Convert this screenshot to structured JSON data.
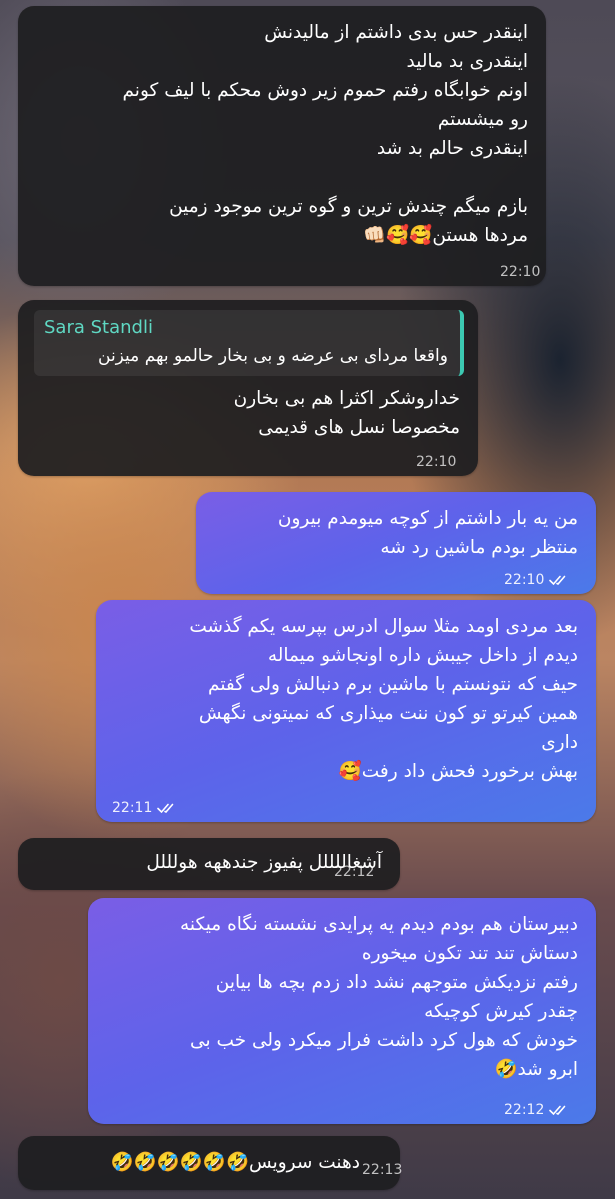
{
  "messages": [
    {
      "id": "m1",
      "side": "incoming",
      "lines": [
        "اینقدر حس بدی داشتم از مالیدنش",
        "اینقدری بد مالید",
        "اونم خوابگاه رفتم حموم زیر دوش محکم با لیف کونم",
        "رو میشستم",
        "اینقدری حالم بد شد",
        "",
        "بازم میگم چندش ترین و گوه ترین موجود زمین",
        "مردها هستن🥰🥰👊🏻"
      ],
      "time": "22:10"
    },
    {
      "id": "m2",
      "side": "incoming",
      "reply": {
        "sender": "Sara Standli",
        "text": "واقعا مردای بی عرضه و بی بخار حالمو بهم میزنن"
      },
      "lines": [
        "خداروشکر اکثرا هم بی بخارن",
        "مخصوصا نسل های قدیمی"
      ],
      "time": "22:10"
    },
    {
      "id": "m3",
      "side": "outgoing",
      "lines": [
        "من یه بار داشتم از کوچه میومدم بیرون",
        "منتظر بودم ماشین رد شه"
      ],
      "time": "22:10",
      "status": "read"
    },
    {
      "id": "m4",
      "side": "outgoing",
      "lines": [
        "بعد مردی اومد مثلا سوال ادرس بپرسه یکم گذشت",
        "دیدم از داخل جیبش  داره اونجاشو میماله",
        "حیف که نتونستم با ماشین برم دنبالش ولی گفتم",
        "همین کیرتو تو کون ننت میذاری که نمیتونی نگهش",
        "داری",
        "بهش برخورد فحش داد رفت🥰"
      ],
      "time": "22:11",
      "status": "read"
    },
    {
      "id": "m5",
      "side": "incoming",
      "lines": [
        "آشغاللللل پفیوز جندههه هولللل"
      ],
      "time": "22:12"
    },
    {
      "id": "m6",
      "side": "outgoing",
      "lines": [
        "دبیرستان هم بودم دیدم یه پرایدی نشسته نگاه میکنه",
        "دستاش تند تند تکون میخوره",
        "رفتم نزدیکش متوجهم نشد داد زدم بچه ها بیاین",
        "چقدر کیرش کوچیکه",
        "خودش که هول کرد داشت فرار میکرد ولی خب بی",
        "ابرو شد🤣"
      ],
      "time": "22:12",
      "status": "read"
    },
    {
      "id": "m7",
      "side": "incoming",
      "lines": [
        "دهنت سرویس🤣🤣🤣🤣🤣🤣"
      ],
      "time": "22:13"
    }
  ]
}
